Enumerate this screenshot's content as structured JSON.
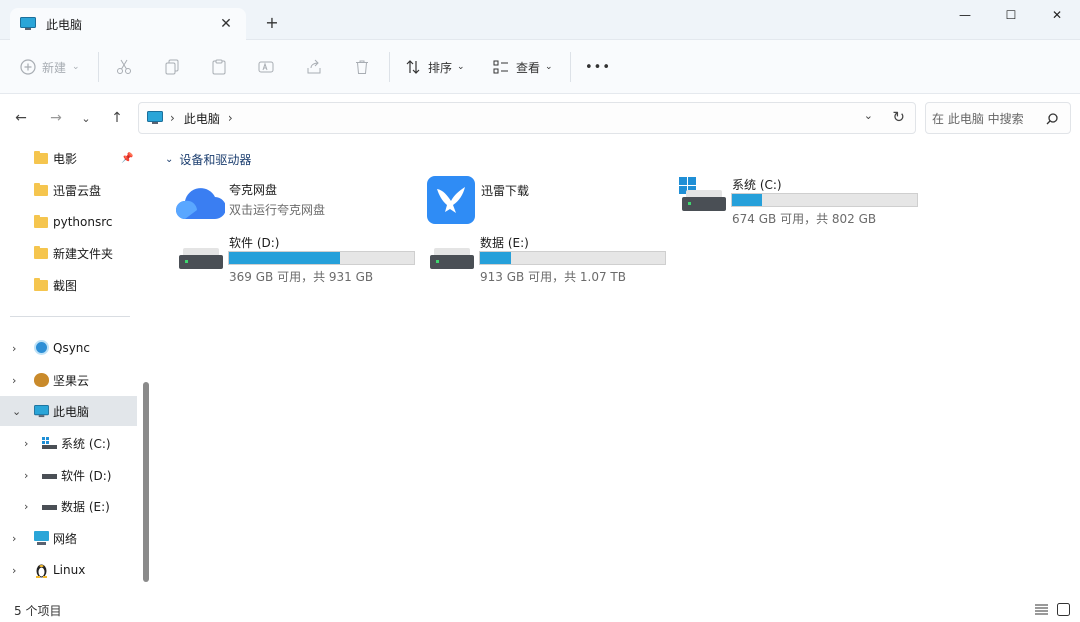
{
  "window": {
    "tab_title": "此电脑",
    "controls": {
      "minimize": "—",
      "maximize": "☐",
      "close": "✕"
    }
  },
  "toolbar": {
    "new_label": "新建",
    "sort_label": "排序",
    "view_label": "查看",
    "more": "•••"
  },
  "address": {
    "path_root": "此电脑",
    "search_placeholder": "在 此电脑 中搜索"
  },
  "sidebar": {
    "pinned": [
      {
        "label": "电影",
        "pinned": true
      },
      {
        "label": "迅雷云盘"
      },
      {
        "label": "pythonsrc"
      },
      {
        "label": "新建文件夹"
      },
      {
        "label": "截图"
      }
    ],
    "tree": [
      {
        "label": "Qsync"
      },
      {
        "label": "坚果云"
      },
      {
        "label": "此电脑",
        "selected": true
      },
      {
        "label": "系统 (C:)"
      },
      {
        "label": "软件 (D:)"
      },
      {
        "label": "数据 (E:)"
      },
      {
        "label": "网络"
      },
      {
        "label": "Linux"
      }
    ]
  },
  "main": {
    "group_label": "设备和驱动器",
    "apps": [
      {
        "name": "夸克网盘",
        "sub": "双击运行夸克网盘"
      },
      {
        "name": "迅雷下载"
      }
    ],
    "drives": [
      {
        "name": "系统 (C:)",
        "info": "674 GB 可用，共 802 GB",
        "used_fraction": 0.16
      },
      {
        "name": "软件 (D:)",
        "info": "369 GB 可用，共 931 GB",
        "used_fraction": 0.6
      },
      {
        "name": "数据 (E:)",
        "info": "913 GB 可用，共 1.07 TB",
        "used_fraction": 0.17
      }
    ]
  },
  "status": {
    "count_text": "5 个项目"
  },
  "colors": {
    "accent": "#26a0da",
    "titlebar": "#eff4f9"
  }
}
